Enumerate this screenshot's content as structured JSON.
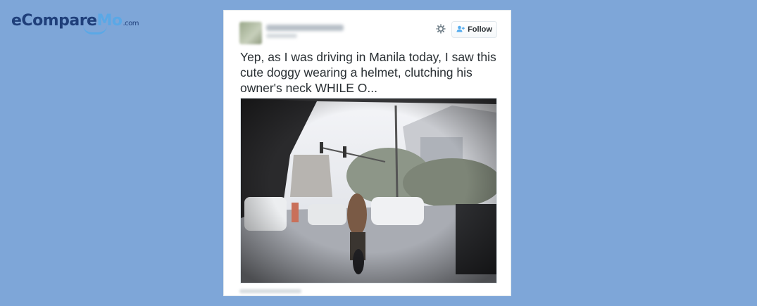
{
  "brand": {
    "logo_main": "eCompare",
    "logo_accent": "Mo",
    "logo_suffix": ".com"
  },
  "tweet": {
    "follow_label": "Follow",
    "text": "Yep, as I was driving in Manila today, I saw this cute doggy wearing a helmet, clutching his owner's neck WHILE O...",
    "icons": {
      "settings": "gear-icon",
      "follow": "add-user-icon"
    },
    "colors": {
      "follow_icon": "#55acee",
      "text": "#292f33",
      "background": "#7ea6d8"
    }
  }
}
